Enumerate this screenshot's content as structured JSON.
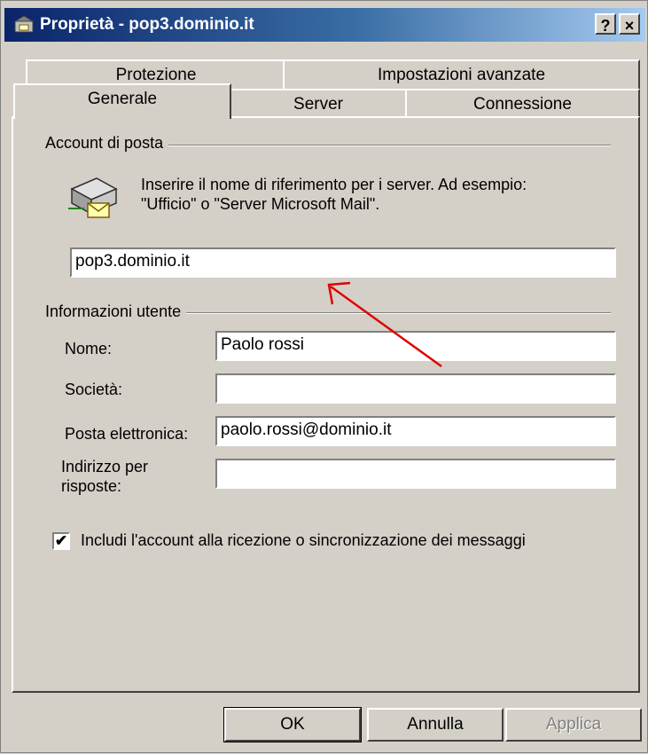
{
  "window": {
    "title": "Proprietà - pop3.dominio.it",
    "help_button": "?",
    "close_button": "×"
  },
  "tabs": {
    "row_back": [
      "Protezione",
      "Impostazioni avanzate"
    ],
    "row_front": [
      "Generale",
      "Server",
      "Connessione"
    ],
    "active": "Generale"
  },
  "account": {
    "group_label": "Account di posta",
    "description_line1": "Inserire il nome di riferimento per i server. Ad esempio:",
    "description_line2": "\"Ufficio\" o \"Server Microsoft Mail\".",
    "name_value": "pop3.dominio.it"
  },
  "user_info": {
    "group_label": "Informazioni utente",
    "name_label": "Nome:",
    "name_value": "Paolo rossi",
    "company_label": "Società:",
    "company_value": "",
    "email_label": "Posta elettronica:",
    "email_value": "paolo.rossi@dominio.it",
    "reply_label_line1": "Indirizzo per",
    "reply_label_line2": "risposte:",
    "reply_value": ""
  },
  "include_checkbox": {
    "checked": true,
    "label": "Includi l'account alla ricezione o sincronizzazione dei messaggi"
  },
  "buttons": {
    "ok": "OK",
    "cancel": "Annulla",
    "apply": "Applica"
  },
  "colors": {
    "annotation_arrow": "#e00000",
    "titlebar_start": "#0a246a",
    "titlebar_end": "#a6caf0"
  }
}
